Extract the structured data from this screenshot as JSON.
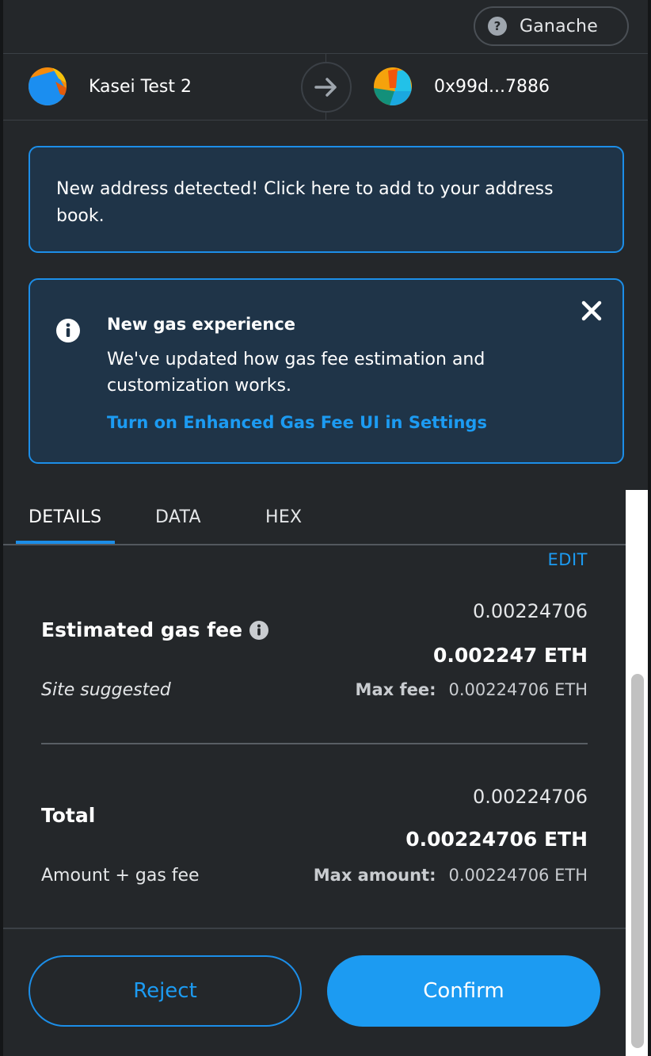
{
  "network": {
    "name": "Ganache",
    "help_icon": "question-circle-icon"
  },
  "sender": {
    "name": "Kasei Test 2"
  },
  "recipient": {
    "address": "0x99d...7886"
  },
  "address_banner": {
    "text": "New address detected! Click here to add to your address book."
  },
  "gas_banner": {
    "title": "New gas experience",
    "description": "We've updated how gas fee estimation and customization works.",
    "link": "Turn on Enhanced Gas Fee UI in Settings"
  },
  "tabs": [
    {
      "label": "DETAILS",
      "active": true
    },
    {
      "label": "DATA",
      "active": false
    },
    {
      "label": "HEX",
      "active": false
    }
  ],
  "details": {
    "edit_label": "EDIT",
    "gas_fee": {
      "label": "Estimated gas fee",
      "secondary_value": "0.00224706",
      "primary_value": "0.002247 ETH",
      "sub_label": "Site suggested",
      "max_label": "Max fee:",
      "max_value": "0.00224706 ETH"
    },
    "total": {
      "label": "Total",
      "secondary_value": "0.00224706",
      "primary_value": "0.00224706 ETH",
      "sub_label": "Amount + gas fee",
      "max_label": "Max amount:",
      "max_value": "0.00224706 ETH"
    }
  },
  "actions": {
    "reject": "Reject",
    "confirm": "Confirm"
  },
  "colors": {
    "accent": "#1c9bf2",
    "background": "#24272a",
    "banner_bg": "#1f3448"
  }
}
